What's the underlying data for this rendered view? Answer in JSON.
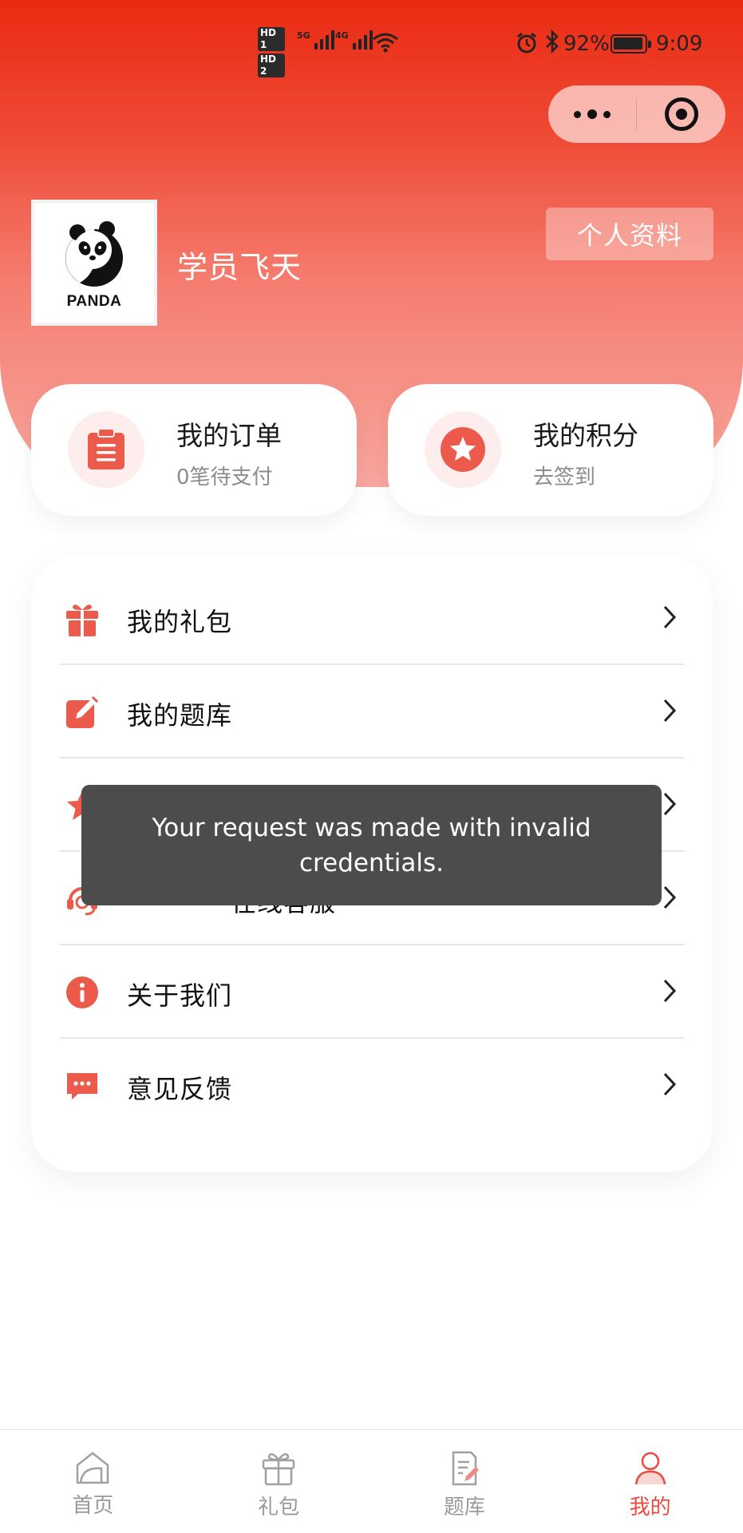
{
  "status_bar": {
    "sim1": "HD 1",
    "sim2": "HD 2",
    "net1": "5G",
    "net2": "4G",
    "battery": "92%",
    "time": "9:09"
  },
  "capsule": {
    "more_icon": "more-dots-icon",
    "close_icon": "target-close-icon"
  },
  "profile": {
    "avatar_text": "PANDA",
    "username": "学员飞天",
    "profile_button": "个人资料"
  },
  "cards": [
    {
      "title": "我的订单",
      "subtitle": "0笔待支付",
      "icon": "clipboard-icon"
    },
    {
      "title": "我的积分",
      "subtitle": "去签到",
      "icon": "star-badge-icon"
    }
  ],
  "menu": [
    {
      "label": "我的礼包",
      "icon": "gift-icon"
    },
    {
      "label": "我的题库",
      "icon": "edit-icon"
    },
    {
      "label": "",
      "icon": "star-icon"
    },
    {
      "label": "在线客服",
      "icon": "headset-icon"
    },
    {
      "label": "关于我们",
      "icon": "info-icon"
    },
    {
      "label": "意见反馈",
      "icon": "message-icon"
    }
  ],
  "toast": "Your request was made with invalid credentials.",
  "tabbar": [
    {
      "label": "首页",
      "icon": "home-icon"
    },
    {
      "label": "礼包",
      "icon": "gift-icon"
    },
    {
      "label": "题库",
      "icon": "question-bank-icon"
    },
    {
      "label": "我的",
      "icon": "user-icon"
    }
  ],
  "colors": {
    "accent": "#e94c3f",
    "header_top": "#ea2a12",
    "header_bottom": "#f8a79f"
  }
}
